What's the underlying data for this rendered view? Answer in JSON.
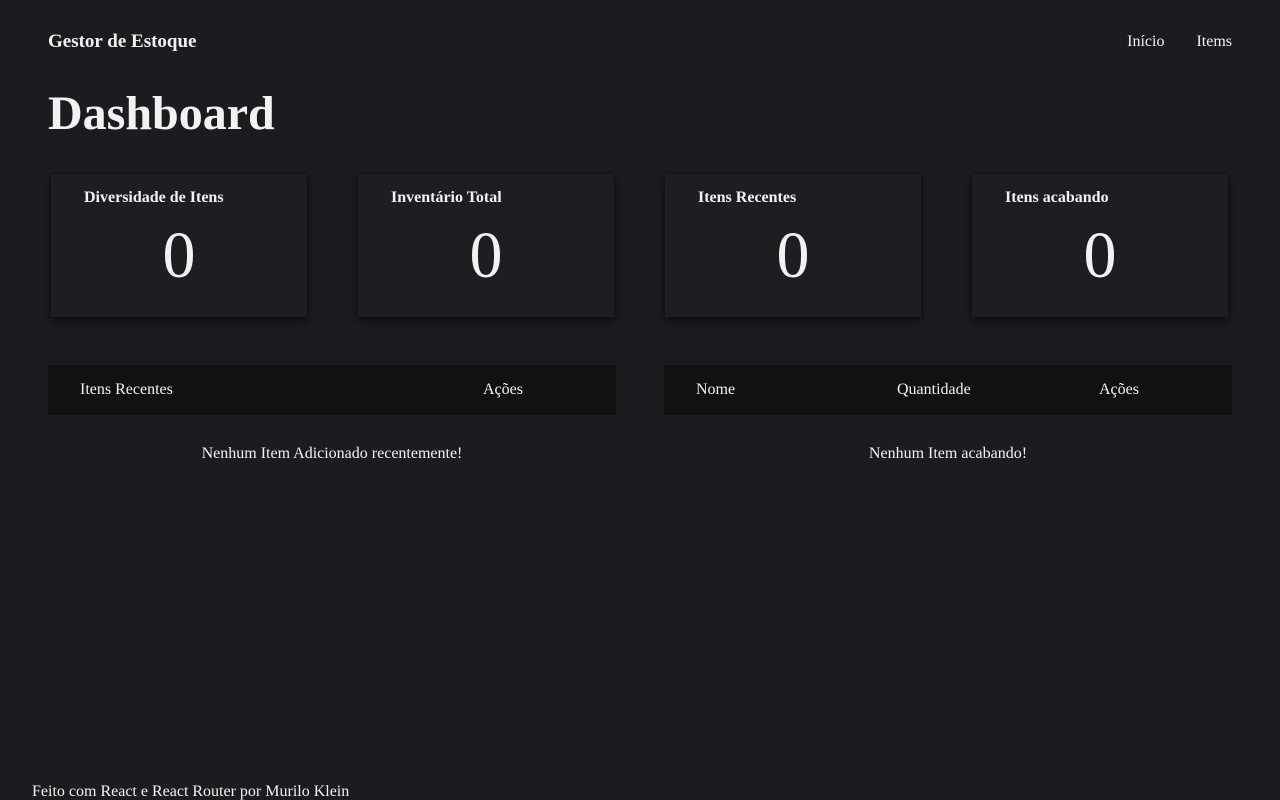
{
  "header": {
    "brand": "Gestor de Estoque",
    "nav": [
      "Início",
      "Items"
    ]
  },
  "page_title": "Dashboard",
  "cards": [
    {
      "title": "Diversidade de Itens",
      "value": "0"
    },
    {
      "title": "Inventário Total",
      "value": "0"
    },
    {
      "title": "Itens Recentes",
      "value": "0"
    },
    {
      "title": "Itens acabando",
      "value": "0"
    }
  ],
  "recent_table": {
    "headers": [
      "Itens Recentes",
      "Ações"
    ],
    "empty_message": "Nenhum Item Adicionado recentemente!"
  },
  "low_stock_table": {
    "headers": [
      "Nome",
      "Quantidade",
      "Ações"
    ],
    "empty_message": "Nenhum Item acabando!"
  },
  "footer": {
    "text": "Feito com React e React Router por Murilo Klein"
  }
}
